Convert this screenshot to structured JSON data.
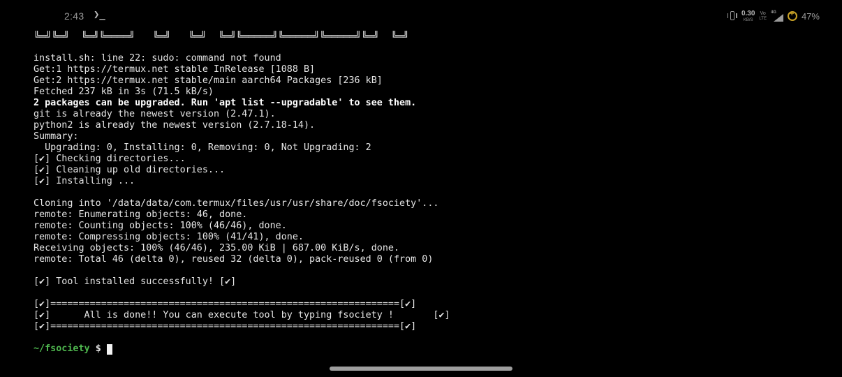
{
  "status_bar": {
    "time": "2:43",
    "app_icon_glyph": "❯_",
    "net_speed_value": "0.30",
    "net_speed_unit": "KB/S",
    "volte_top": "Vo",
    "volte_bottom": "LTE",
    "network_type": "4G",
    "battery_percent": "47%",
    "icons": [
      "terminal-app-icon",
      "vibrate-icon",
      "signal-icon",
      "battery-saver-icon"
    ]
  },
  "terminal": {
    "banner_partial": "╚═╝╚═╝  ╚═╝╚════╝   ╚═╝   ╚═╝  ╚═╝╚═════╝╚═════╝╚═════╝╚═╝  ╚═╝",
    "lines": [
      {
        "text": "",
        "bold": false
      },
      {
        "text": "install.sh: line 22: sudo: command not found",
        "bold": false
      },
      {
        "text": "Get:1 https://termux.net stable InRelease [1088 B]",
        "bold": false
      },
      {
        "text": "Get:2 https://termux.net stable/main aarch64 Packages [236 kB]",
        "bold": false
      },
      {
        "text": "Fetched 237 kB in 3s (71.5 kB/s)",
        "bold": false
      },
      {
        "text": "2 packages can be upgraded. Run 'apt list --upgradable' to see them.",
        "bold": true
      },
      {
        "text": "git is already the newest version (2.47.1).",
        "bold": false
      },
      {
        "text": "python2 is already the newest version (2.7.18-14).",
        "bold": false
      },
      {
        "text": "Summary:",
        "bold": false
      },
      {
        "text": "  Upgrading: 0, Installing: 0, Removing: 0, Not Upgrading: 2",
        "bold": false
      },
      {
        "text": "[✔] Checking directories...",
        "bold": false
      },
      {
        "text": "[✔] Cleaning up old directories...",
        "bold": false
      },
      {
        "text": "[✔] Installing ...",
        "bold": false
      },
      {
        "text": "",
        "bold": false
      },
      {
        "text": "Cloning into '/data/data/com.termux/files/usr/usr/share/doc/fsociety'...",
        "bold": false
      },
      {
        "text": "remote: Enumerating objects: 46, done.",
        "bold": false
      },
      {
        "text": "remote: Counting objects: 100% (46/46), done.",
        "bold": false
      },
      {
        "text": "remote: Compressing objects: 100% (41/41), done.",
        "bold": false
      },
      {
        "text": "Receiving objects: 100% (46/46), 235.00 KiB | 687.00 KiB/s, done.",
        "bold": false
      },
      {
        "text": "remote: Total 46 (delta 0), reused 32 (delta 0), pack-reused 0 (from 0)",
        "bold": false
      },
      {
        "text": "",
        "bold": false
      },
      {
        "text": "[✔] Tool installed successfully! [✔]",
        "bold": false
      },
      {
        "text": "",
        "bold": false
      },
      {
        "text": "[✔]==============================================================[✔]",
        "bold": false
      },
      {
        "text": "[✔]      All is done!! You can execute tool by typing fsociety !       [✔]",
        "bold": false
      },
      {
        "text": "[✔]==============================================================[✔]",
        "bold": false
      },
      {
        "text": "",
        "bold": false
      }
    ],
    "prompt_path": "~/fsociety",
    "prompt_symbol": "$"
  },
  "colors": {
    "background": "#000000",
    "text": "#e6e6e6",
    "prompt_green": "#4fb84f",
    "status_text": "#9a9a9a",
    "battery_saver": "#c9a227"
  }
}
